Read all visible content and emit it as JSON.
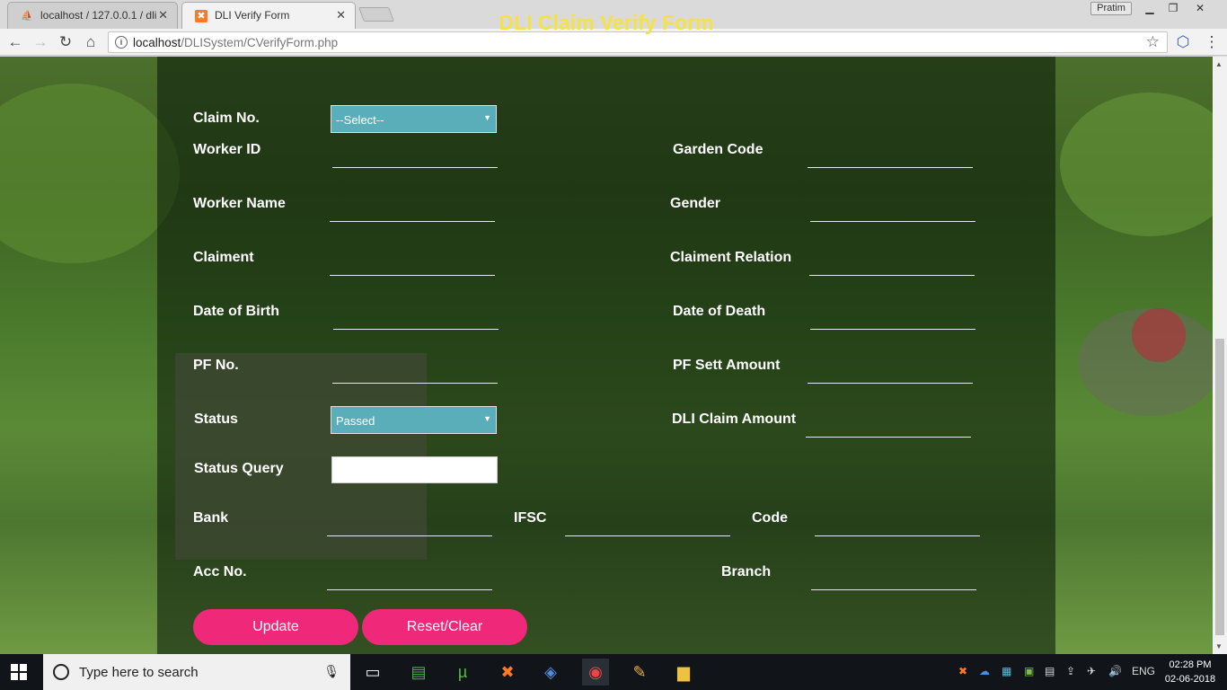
{
  "browser": {
    "tabs": [
      {
        "title": "localhost / 127.0.0.1 / dli",
        "active": false
      },
      {
        "title": "DLI Verify Form",
        "active": true
      }
    ],
    "profile": "Pratim",
    "url_host": "localhost",
    "url_path": "/DLISystem/CVerifyForm.php"
  },
  "form": {
    "title": "DLI Claim Verify Form",
    "claim_no_label": "Claim No.",
    "claim_no_value": "--Select--",
    "worker_id_label": "Worker ID",
    "garden_code_label": "Garden Code",
    "worker_name_label": "Worker Name",
    "gender_label": "Gender",
    "claiment_label": "Claiment",
    "claiment_relation_label": "Claiment Relation",
    "dob_label": "Date of Birth",
    "dod_label": "Date of Death",
    "pf_no_label": "PF No.",
    "pf_sett_label": "PF Sett Amount",
    "status_label": "Status",
    "status_value": "Passed",
    "dli_claim_label": "DLI Claim Amount",
    "status_query_label": "Status Query",
    "bank_label": "Bank",
    "ifsc_label": "IFSC",
    "code_label": "Code",
    "acc_no_label": "Acc No.",
    "branch_label": "Branch",
    "update_label": "Update",
    "reset_label": "Reset/Clear"
  },
  "taskbar": {
    "search_placeholder": "Type here to search",
    "language": "ENG",
    "time": "02:28 PM",
    "date": "02-06-2018"
  }
}
